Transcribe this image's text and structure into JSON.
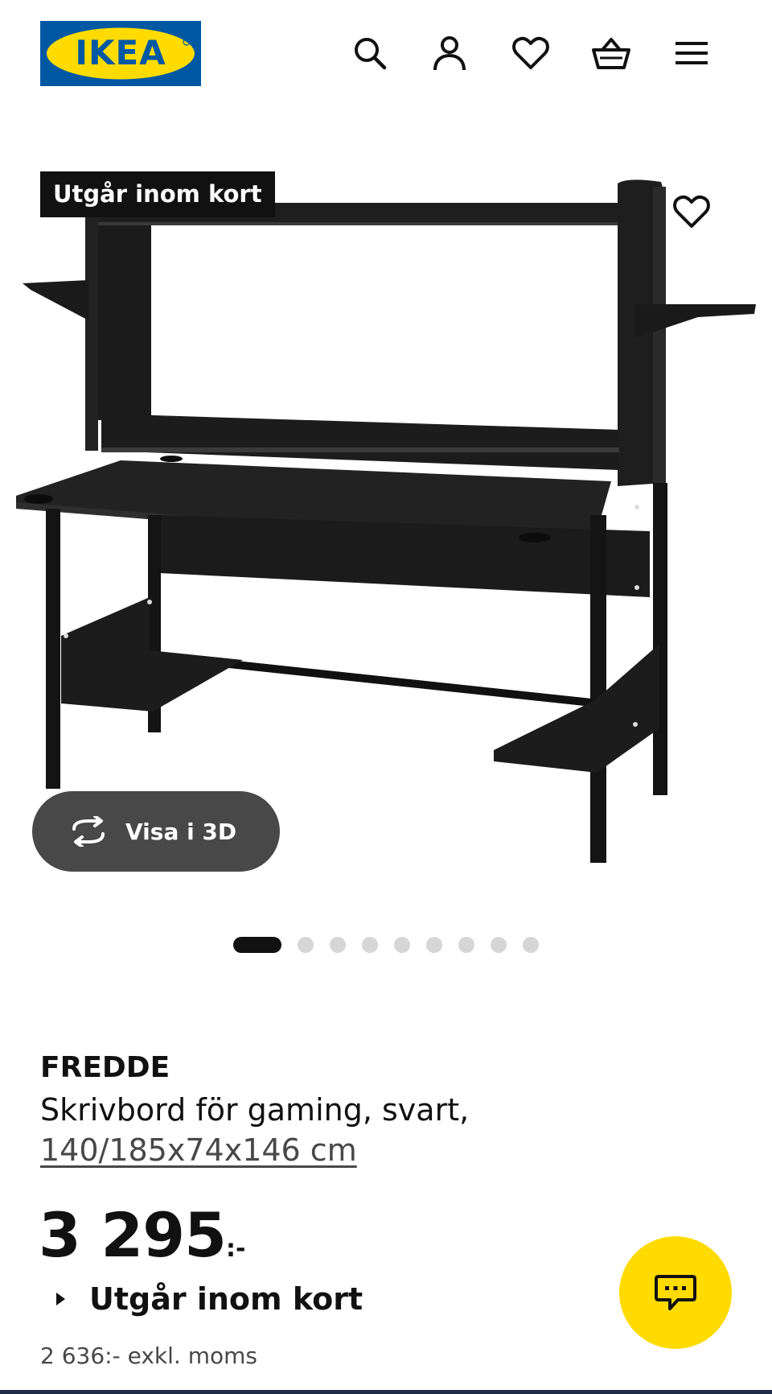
{
  "header": {
    "logo_text": "IKEA",
    "brand_blue": "#0058a3",
    "brand_yellow": "#ffdb00",
    "icons": [
      "search-icon",
      "user-icon",
      "heart-icon",
      "basket-icon",
      "hamburger-menu-icon"
    ]
  },
  "gallery": {
    "badge": "Utgår inom kort",
    "view_3d_label": "Visa i 3D",
    "image_count": 9,
    "active_image": 1,
    "image_subject": "gaming desk, black"
  },
  "product": {
    "name": "FREDDE",
    "description": "Skrivbord för gaming, svart,",
    "measurements": "140/185x74x146 cm",
    "price_integer": "3 295",
    "price_suffix": ":-",
    "availability": "Utgår inom kort",
    "price_ex_vat": "2 636:- exkl. moms"
  },
  "chat": {
    "icon": "chat-icon",
    "background": "#ffdb00"
  }
}
